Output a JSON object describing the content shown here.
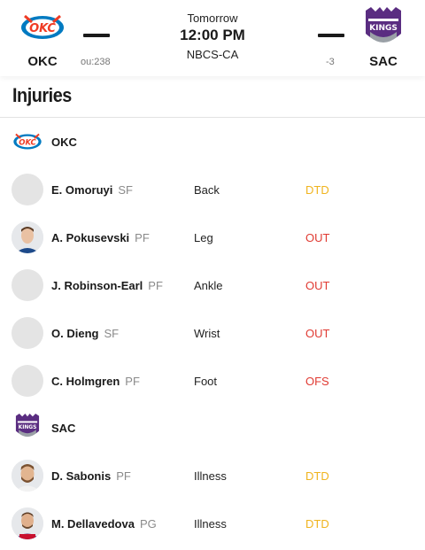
{
  "game": {
    "away": {
      "abbr": "OKC",
      "odds": "ou:238"
    },
    "home": {
      "abbr": "SAC",
      "odds": "-3"
    },
    "day": "Tomorrow",
    "time": "12:00 PM",
    "network": "NBCS-CA"
  },
  "section_title": "Injuries",
  "colors": {
    "dtd": "#f0b41e",
    "out": "#e03a32",
    "ofs": "#e03a32"
  },
  "teams": [
    {
      "name": "OKC",
      "players": [
        {
          "name": "E. Omoruyi",
          "pos": "SF",
          "part": "Back",
          "status": "DTD",
          "status_key": "dtd",
          "photo": false
        },
        {
          "name": "A. Pokusevski",
          "pos": "PF",
          "part": "Leg",
          "status": "OUT",
          "status_key": "out",
          "photo": true
        },
        {
          "name": "J. Robinson-Earl",
          "pos": "PF",
          "part": "Ankle",
          "status": "OUT",
          "status_key": "out",
          "photo": false
        },
        {
          "name": "O. Dieng",
          "pos": "SF",
          "part": "Wrist",
          "status": "OUT",
          "status_key": "out",
          "photo": false
        },
        {
          "name": "C. Holmgren",
          "pos": "PF",
          "part": "Foot",
          "status": "OFS",
          "status_key": "ofs",
          "photo": false
        }
      ]
    },
    {
      "name": "SAC",
      "players": [
        {
          "name": "D. Sabonis",
          "pos": "PF",
          "part": "Illness",
          "status": "DTD",
          "status_key": "dtd",
          "photo": true
        },
        {
          "name": "M. Dellavedova",
          "pos": "PG",
          "part": "Illness",
          "status": "DTD",
          "status_key": "dtd",
          "photo": true
        }
      ]
    }
  ]
}
